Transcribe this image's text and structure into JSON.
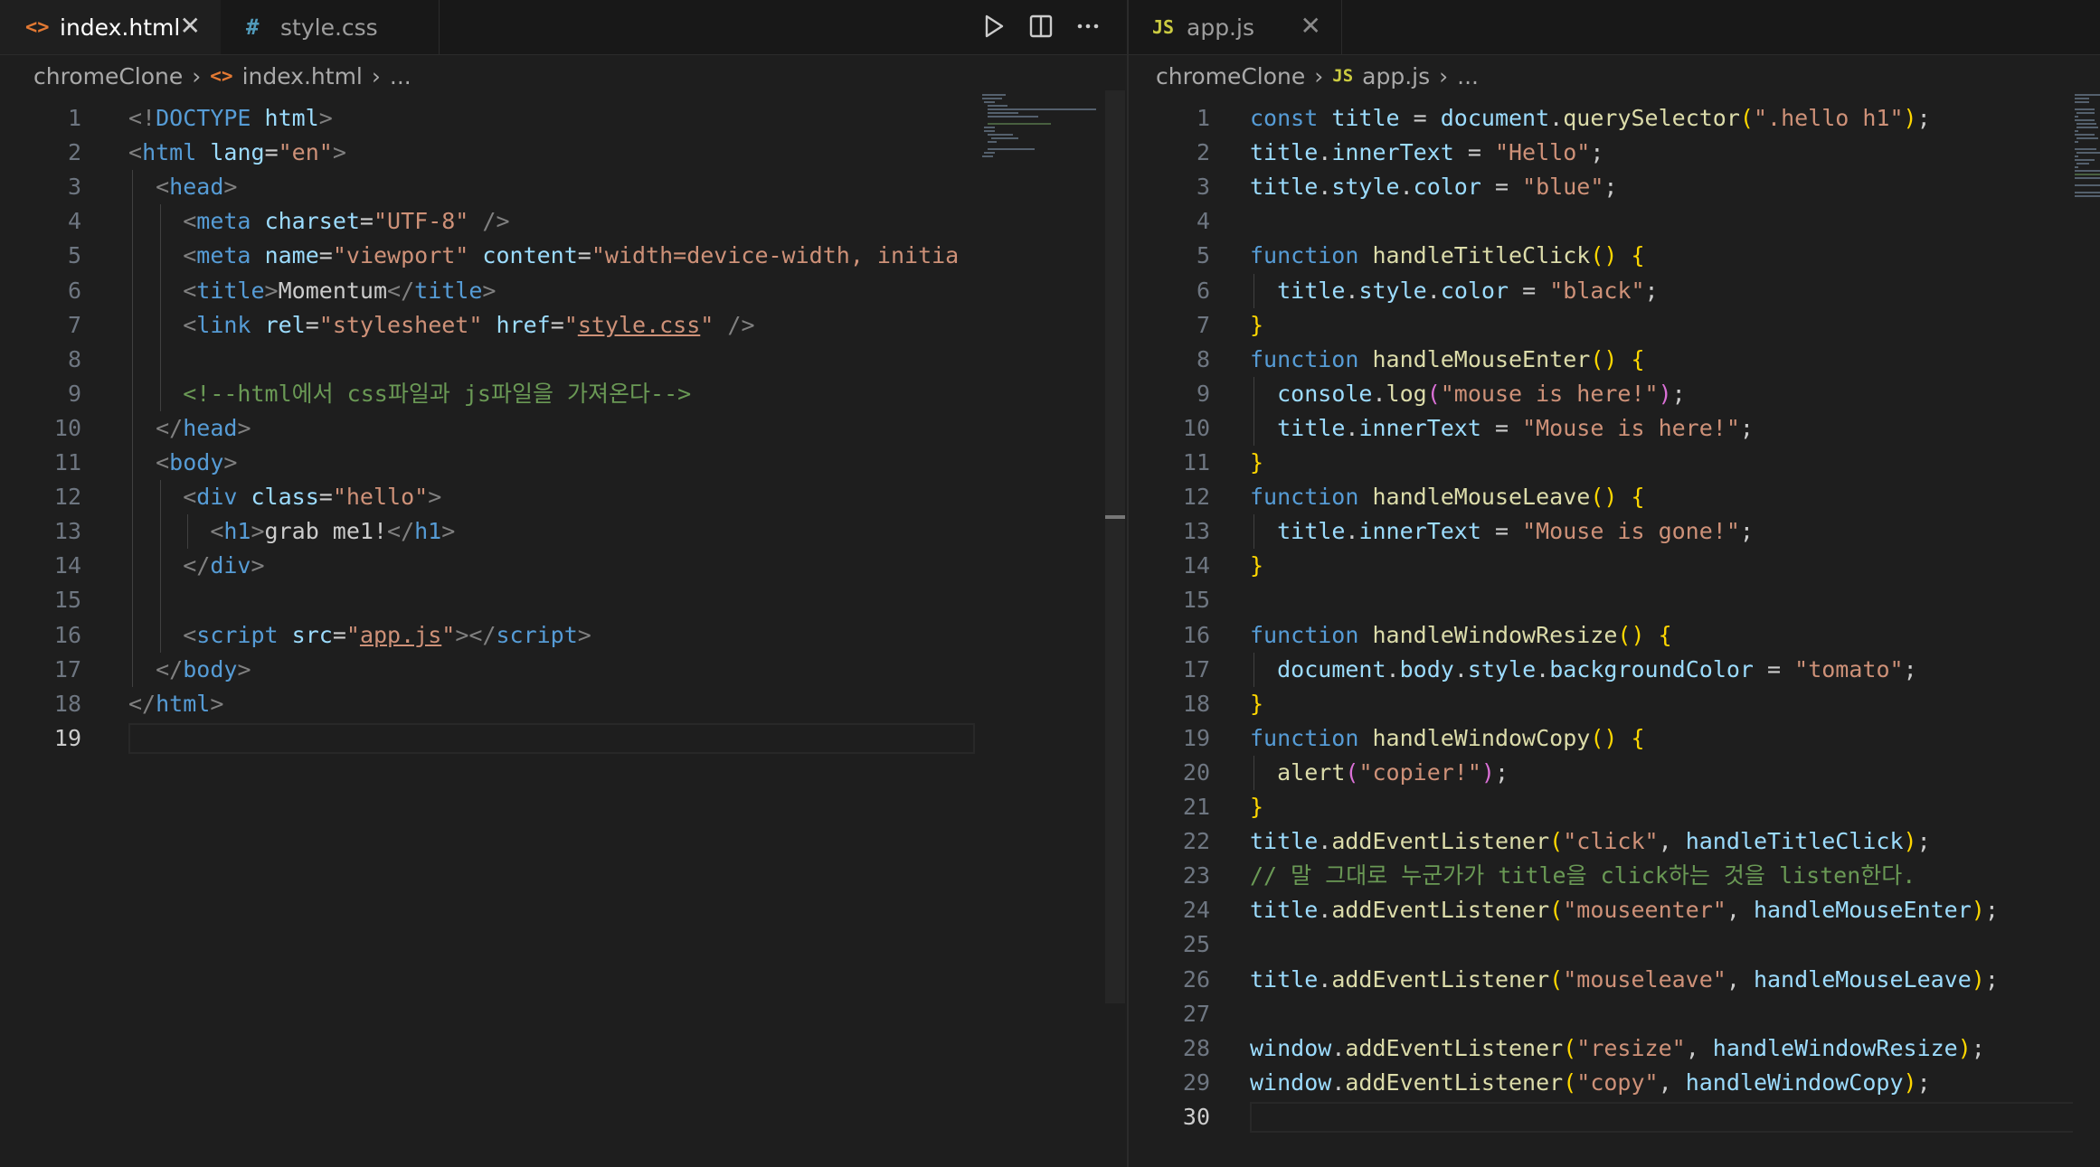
{
  "left": {
    "tabs": [
      {
        "label": "index.html",
        "icon": "html-file-icon",
        "active": true
      },
      {
        "label": "style.css",
        "icon": "css-file-icon",
        "active": false
      }
    ],
    "breadcrumb": {
      "folder": "chromeClone",
      "file": "index.html",
      "more": "..."
    },
    "current_line": 19,
    "lines": [
      [
        [
          "p",
          "<!"
        ],
        [
          "k",
          "DOCTYPE"
        ],
        [
          "t",
          " "
        ],
        [
          "a",
          "html"
        ],
        [
          "p",
          ">"
        ]
      ],
      [
        [
          "p",
          "<"
        ],
        [
          "k",
          "html"
        ],
        [
          "t",
          " "
        ],
        [
          "a",
          "lang"
        ],
        [
          "t",
          "="
        ],
        [
          "s",
          "\"en\""
        ],
        [
          "p",
          ">"
        ]
      ],
      [
        [
          "t",
          "  "
        ],
        [
          "p",
          "<"
        ],
        [
          "k",
          "head"
        ],
        [
          "p",
          ">"
        ]
      ],
      [
        [
          "t",
          "    "
        ],
        [
          "p",
          "<"
        ],
        [
          "k",
          "meta"
        ],
        [
          "t",
          " "
        ],
        [
          "a",
          "charset"
        ],
        [
          "t",
          "="
        ],
        [
          "s",
          "\"UTF-8\""
        ],
        [
          "t",
          " "
        ],
        [
          "p",
          "/>"
        ]
      ],
      [
        [
          "t",
          "    "
        ],
        [
          "p",
          "<"
        ],
        [
          "k",
          "meta"
        ],
        [
          "t",
          " "
        ],
        [
          "a",
          "name"
        ],
        [
          "t",
          "="
        ],
        [
          "s",
          "\"viewport\""
        ],
        [
          "t",
          " "
        ],
        [
          "a",
          "content"
        ],
        [
          "t",
          "="
        ],
        [
          "s",
          "\"width=device-width, initia"
        ]
      ],
      [
        [
          "t",
          "    "
        ],
        [
          "p",
          "<"
        ],
        [
          "k",
          "title"
        ],
        [
          "p",
          ">"
        ],
        [
          "t",
          "Momentum"
        ],
        [
          "p",
          "</"
        ],
        [
          "k",
          "title"
        ],
        [
          "p",
          ">"
        ]
      ],
      [
        [
          "t",
          "    "
        ],
        [
          "p",
          "<"
        ],
        [
          "k",
          "link"
        ],
        [
          "t",
          " "
        ],
        [
          "a",
          "rel"
        ],
        [
          "t",
          "="
        ],
        [
          "s",
          "\"stylesheet\""
        ],
        [
          "t",
          " "
        ],
        [
          "a",
          "href"
        ],
        [
          "t",
          "="
        ],
        [
          "s",
          "\""
        ],
        [
          "su",
          "style.css"
        ],
        [
          "s",
          "\""
        ],
        [
          "t",
          " "
        ],
        [
          "p",
          "/>"
        ]
      ],
      [],
      [
        [
          "t",
          "    "
        ],
        [
          "c",
          "<!--html에서 css파일과 js파일을 가져온다-->"
        ]
      ],
      [
        [
          "t",
          "  "
        ],
        [
          "p",
          "</"
        ],
        [
          "k",
          "head"
        ],
        [
          "p",
          ">"
        ]
      ],
      [
        [
          "t",
          "  "
        ],
        [
          "p",
          "<"
        ],
        [
          "k",
          "body"
        ],
        [
          "p",
          ">"
        ]
      ],
      [
        [
          "t",
          "    "
        ],
        [
          "p",
          "<"
        ],
        [
          "k",
          "div"
        ],
        [
          "t",
          " "
        ],
        [
          "a",
          "class"
        ],
        [
          "t",
          "="
        ],
        [
          "s",
          "\"hello\""
        ],
        [
          "p",
          ">"
        ]
      ],
      [
        [
          "t",
          "      "
        ],
        [
          "p",
          "<"
        ],
        [
          "k",
          "h1"
        ],
        [
          "p",
          ">"
        ],
        [
          "t",
          "grab me1!"
        ],
        [
          "p",
          "</"
        ],
        [
          "k",
          "h1"
        ],
        [
          "p",
          ">"
        ]
      ],
      [
        [
          "t",
          "    "
        ],
        [
          "p",
          "</"
        ],
        [
          "k",
          "div"
        ],
        [
          "p",
          ">"
        ]
      ],
      [],
      [
        [
          "t",
          "    "
        ],
        [
          "p",
          "<"
        ],
        [
          "k",
          "script"
        ],
        [
          "t",
          " "
        ],
        [
          "a",
          "src"
        ],
        [
          "t",
          "="
        ],
        [
          "s",
          "\""
        ],
        [
          "su",
          "app.js"
        ],
        [
          "s",
          "\""
        ],
        [
          "p",
          "></"
        ],
        [
          "k",
          "script"
        ],
        [
          "p",
          ">"
        ]
      ],
      [
        [
          "t",
          "  "
        ],
        [
          "p",
          "</"
        ],
        [
          "k",
          "body"
        ],
        [
          "p",
          ">"
        ]
      ],
      [
        [
          "p",
          "</"
        ],
        [
          "k",
          "html"
        ],
        [
          "p",
          ">"
        ]
      ],
      []
    ]
  },
  "right": {
    "tabs": [
      {
        "label": "app.js",
        "icon": "js-file-icon",
        "active": false
      }
    ],
    "breadcrumb": {
      "folder": "chromeClone",
      "file": "app.js",
      "more": "..."
    },
    "current_line": 30,
    "lines": [
      [
        [
          "k",
          "const"
        ],
        [
          "t",
          " "
        ],
        [
          "v",
          "title"
        ],
        [
          "t",
          " = "
        ],
        [
          "v",
          "document"
        ],
        [
          "t",
          "."
        ],
        [
          "f",
          "querySelector"
        ],
        [
          "y",
          "("
        ],
        [
          "s",
          "\".hello h1\""
        ],
        [
          "y",
          ")"
        ],
        [
          "t",
          ";"
        ]
      ],
      [
        [
          "v",
          "title"
        ],
        [
          "t",
          "."
        ],
        [
          "v",
          "innerText"
        ],
        [
          "t",
          " = "
        ],
        [
          "s",
          "\"Hello\""
        ],
        [
          "t",
          ";"
        ]
      ],
      [
        [
          "v",
          "title"
        ],
        [
          "t",
          "."
        ],
        [
          "v",
          "style"
        ],
        [
          "t",
          "."
        ],
        [
          "v",
          "color"
        ],
        [
          "t",
          " = "
        ],
        [
          "s",
          "\"blue\""
        ],
        [
          "t",
          ";"
        ]
      ],
      [],
      [
        [
          "k",
          "function"
        ],
        [
          "t",
          " "
        ],
        [
          "f",
          "handleTitleClick"
        ],
        [
          "y",
          "() {"
        ]
      ],
      [
        [
          "t",
          "  "
        ],
        [
          "v",
          "title"
        ],
        [
          "t",
          "."
        ],
        [
          "v",
          "style"
        ],
        [
          "t",
          "."
        ],
        [
          "v",
          "color"
        ],
        [
          "t",
          " = "
        ],
        [
          "s",
          "\"black\""
        ],
        [
          "t",
          ";"
        ]
      ],
      [
        [
          "y",
          "}"
        ]
      ],
      [
        [
          "k",
          "function"
        ],
        [
          "t",
          " "
        ],
        [
          "f",
          "handleMouseEnter"
        ],
        [
          "y",
          "() {"
        ]
      ],
      [
        [
          "t",
          "  "
        ],
        [
          "v",
          "console"
        ],
        [
          "t",
          "."
        ],
        [
          "f",
          "log"
        ],
        [
          "m",
          "("
        ],
        [
          "s",
          "\"mouse is here!\""
        ],
        [
          "m",
          ")"
        ],
        [
          "t",
          ";"
        ]
      ],
      [
        [
          "t",
          "  "
        ],
        [
          "v",
          "title"
        ],
        [
          "t",
          "."
        ],
        [
          "v",
          "innerText"
        ],
        [
          "t",
          " = "
        ],
        [
          "s",
          "\"Mouse is here!\""
        ],
        [
          "t",
          ";"
        ]
      ],
      [
        [
          "y",
          "}"
        ]
      ],
      [
        [
          "k",
          "function"
        ],
        [
          "t",
          " "
        ],
        [
          "f",
          "handleMouseLeave"
        ],
        [
          "y",
          "() {"
        ]
      ],
      [
        [
          "t",
          "  "
        ],
        [
          "v",
          "title"
        ],
        [
          "t",
          "."
        ],
        [
          "v",
          "innerText"
        ],
        [
          "t",
          " = "
        ],
        [
          "s",
          "\"Mouse is gone!\""
        ],
        [
          "t",
          ";"
        ]
      ],
      [
        [
          "y",
          "}"
        ]
      ],
      [],
      [
        [
          "k",
          "function"
        ],
        [
          "t",
          " "
        ],
        [
          "f",
          "handleWindowResize"
        ],
        [
          "y",
          "() {"
        ]
      ],
      [
        [
          "t",
          "  "
        ],
        [
          "v",
          "document"
        ],
        [
          "t",
          "."
        ],
        [
          "v",
          "body"
        ],
        [
          "t",
          "."
        ],
        [
          "v",
          "style"
        ],
        [
          "t",
          "."
        ],
        [
          "v",
          "backgroundColor"
        ],
        [
          "t",
          " = "
        ],
        [
          "s",
          "\"tomato\""
        ],
        [
          "t",
          ";"
        ]
      ],
      [
        [
          "y",
          "}"
        ]
      ],
      [
        [
          "k",
          "function"
        ],
        [
          "t",
          " "
        ],
        [
          "f",
          "handleWindowCopy"
        ],
        [
          "y",
          "() {"
        ]
      ],
      [
        [
          "t",
          "  "
        ],
        [
          "f",
          "alert"
        ],
        [
          "m",
          "("
        ],
        [
          "s",
          "\"copier!\""
        ],
        [
          "m",
          ")"
        ],
        [
          "t",
          ";"
        ]
      ],
      [
        [
          "y",
          "}"
        ]
      ],
      [
        [
          "v",
          "title"
        ],
        [
          "t",
          "."
        ],
        [
          "f",
          "addEventListener"
        ],
        [
          "y",
          "("
        ],
        [
          "s",
          "\"click\""
        ],
        [
          "t",
          ", "
        ],
        [
          "v",
          "handleTitleClick"
        ],
        [
          "y",
          ")"
        ],
        [
          "t",
          ";"
        ]
      ],
      [
        [
          "c",
          "// 말 그대로 누군가가 title을 click하는 것을 listen한다."
        ]
      ],
      [
        [
          "v",
          "title"
        ],
        [
          "t",
          "."
        ],
        [
          "f",
          "addEventListener"
        ],
        [
          "y",
          "("
        ],
        [
          "s",
          "\"mouseenter\""
        ],
        [
          "t",
          ", "
        ],
        [
          "v",
          "handleMouseEnter"
        ],
        [
          "y",
          ")"
        ],
        [
          "t",
          ";"
        ]
      ],
      [],
      [
        [
          "v",
          "title"
        ],
        [
          "t",
          "."
        ],
        [
          "f",
          "addEventListener"
        ],
        [
          "y",
          "("
        ],
        [
          "s",
          "\"mouseleave\""
        ],
        [
          "t",
          ", "
        ],
        [
          "v",
          "handleMouseLeave"
        ],
        [
          "y",
          ")"
        ],
        [
          "t",
          ";"
        ]
      ],
      [],
      [
        [
          "v",
          "window"
        ],
        [
          "t",
          "."
        ],
        [
          "f",
          "addEventListener"
        ],
        [
          "y",
          "("
        ],
        [
          "s",
          "\"resize\""
        ],
        [
          "t",
          ", "
        ],
        [
          "v",
          "handleWindowResize"
        ],
        [
          "y",
          ")"
        ],
        [
          "t",
          ";"
        ]
      ],
      [
        [
          "v",
          "window"
        ],
        [
          "t",
          "."
        ],
        [
          "f",
          "addEventListener"
        ],
        [
          "y",
          "("
        ],
        [
          "s",
          "\"copy\""
        ],
        [
          "t",
          ", "
        ],
        [
          "v",
          "handleWindowCopy"
        ],
        [
          "y",
          ")"
        ],
        [
          "t",
          ";"
        ]
      ],
      []
    ]
  },
  "colors": {
    "editor_bg": "#1e1e1e",
    "tabbar_bg": "#181818",
    "keyword": "#569cd6",
    "string": "#ce9178",
    "function": "#dcdcaa",
    "variable": "#9cdcfe",
    "comment": "#6a9955",
    "bracket": "#ffd700"
  }
}
